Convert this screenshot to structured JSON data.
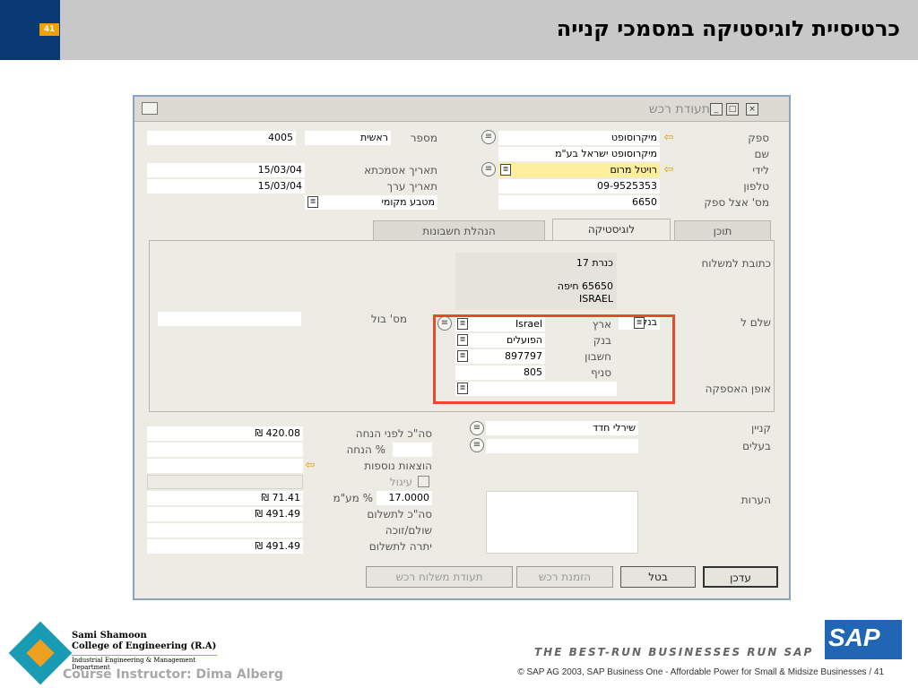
{
  "slide": {
    "number": "41",
    "title": "כרטיסיית לוגיסטיקה במסמכי קנייה"
  },
  "window": {
    "title": "תעודת רכש"
  },
  "header_right": {
    "vendor_label": "ספק",
    "vendor_value": "מיקרוסופט",
    "name_label": "שם",
    "name_value": "מיקרוסופט ישראל בע\"מ",
    "contact_label": "לידי",
    "contact_value": "רויטל מרום",
    "phone_label": "טלפון",
    "phone_value": "09-9525353",
    "vendor_ref_label": "מס' אצל ספק",
    "vendor_ref_value": "6650"
  },
  "header_left": {
    "number_label": "מספר",
    "series_value": "ראשית",
    "number_value": "4005",
    "doc_date_label": "תאריך אסמכתא",
    "doc_date_value": "15/03/04",
    "value_date_label": "תאריך ערך",
    "value_date_value": "15/03/04",
    "currency_value": "מטבע מקומי"
  },
  "tabs": {
    "contents": "תוכן",
    "logistics": "לוגיסטיקה",
    "accounting": "הנהלת חשבונות"
  },
  "logistics": {
    "ship_to_label": "כתובת למשלוח",
    "address_line1": "כנרת 17",
    "address_line2": "65650 חיפה",
    "address_line3": "ISRAEL",
    "pay_to_label": "שלם ל",
    "pay_to_value": "בנקק",
    "stamp_label": "מס' בול",
    "country_label": "ארץ",
    "country_value": "Israel",
    "bank_label": "בנק",
    "bank_value": "הפועלים",
    "account_label": "חשבון",
    "account_value": "897797",
    "branch_label": "סניף",
    "branch_value": "805",
    "shipping_method_label": "אופן האספקה"
  },
  "footer_left": {
    "total_before_disc_label": "סה\"כ לפני הנחה",
    "total_before_disc_value": "₪ 420.08",
    "discount_label": "% הנחה",
    "freight_label": "הוצאות נוספות",
    "rounding_label": "עיגול",
    "vat_label": "% מע\"מ",
    "vat_pct_value": "17.0000",
    "vat_value": "₪ 71.41",
    "total_label": "סה\"כ לתשלום",
    "total_value": "₪ 491.49",
    "paid_label": "שולם/זוכה",
    "balance_label": "יתרה לתשלום",
    "balance_value": "₪ 491.49"
  },
  "footer_right": {
    "buyer_label": "קניין",
    "buyer_value": "שירלי חדד",
    "owner_label": "בעלים",
    "remarks_label": "הערות"
  },
  "buttons": {
    "update": "עדכן",
    "cancel": "בטל",
    "purchase_order": "הזמנת רכש",
    "shipping_doc": "תעודת משלוח רכש"
  },
  "branding": {
    "tagline": "THE BEST-RUN BUSINESSES RUN SAP",
    "copyright": "©  SAP AG 2003, SAP Business One - Affordable Power for Small & Midsize Businesses / 41",
    "sap": "SAP",
    "college_name1": "Sami Shamoon",
    "college_name2": "College of Engineering (R.A)",
    "college_dept": "Industrial Engineering & Management Department",
    "instructor": "Course Instructor: Dima Alberg"
  },
  "colors": {
    "header_bg": "#c8c8c8",
    "number_block": "#0a3a73",
    "number_badge": "#f0a000",
    "highlight_field": "#ffef9c",
    "callout_border": "#e8492a",
    "sap_blue": "#2166b5"
  }
}
